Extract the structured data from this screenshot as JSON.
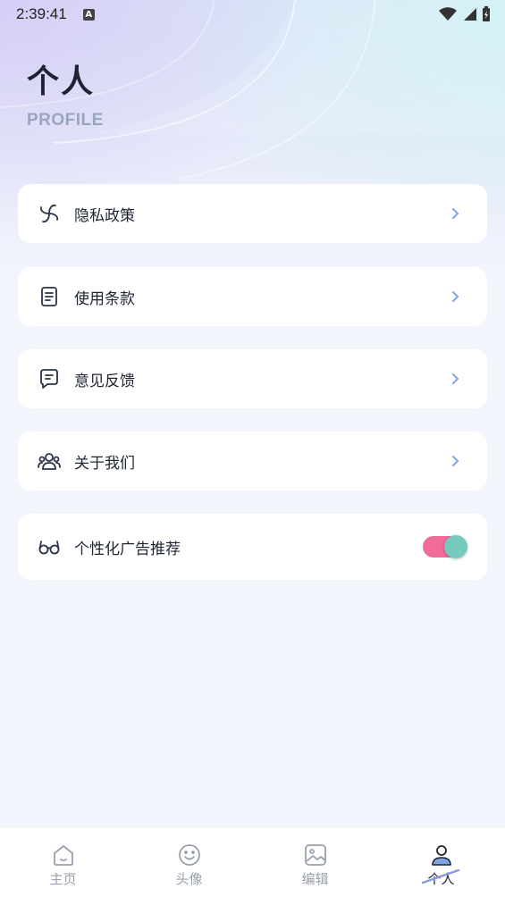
{
  "status_bar": {
    "time": "2:39:41",
    "notification_icon": "a-letter-icon"
  },
  "header": {
    "title": "个人",
    "subtitle": "PROFILE"
  },
  "menu": {
    "items": [
      {
        "label": "隐私政策",
        "icon": "pinwheel-icon"
      },
      {
        "label": "使用条款",
        "icon": "document-icon"
      },
      {
        "label": "意见反馈",
        "icon": "chat-icon"
      },
      {
        "label": "关于我们",
        "icon": "people-icon"
      },
      {
        "label": "个性化广告推荐",
        "icon": "glasses-icon",
        "toggle_on": true
      }
    ]
  },
  "tabbar": {
    "tabs": [
      {
        "label": "主页",
        "icon": "home-icon"
      },
      {
        "label": "头像",
        "icon": "smiley-icon"
      },
      {
        "label": "编辑",
        "icon": "image-icon"
      },
      {
        "label": "个人",
        "icon": "user-icon",
        "active": true
      }
    ]
  },
  "colors": {
    "accent_pink": "#f06a9a",
    "accent_teal": "#76c9bd",
    "chevron": "#7ea6e6",
    "icon_stroke": "#2a3347"
  }
}
